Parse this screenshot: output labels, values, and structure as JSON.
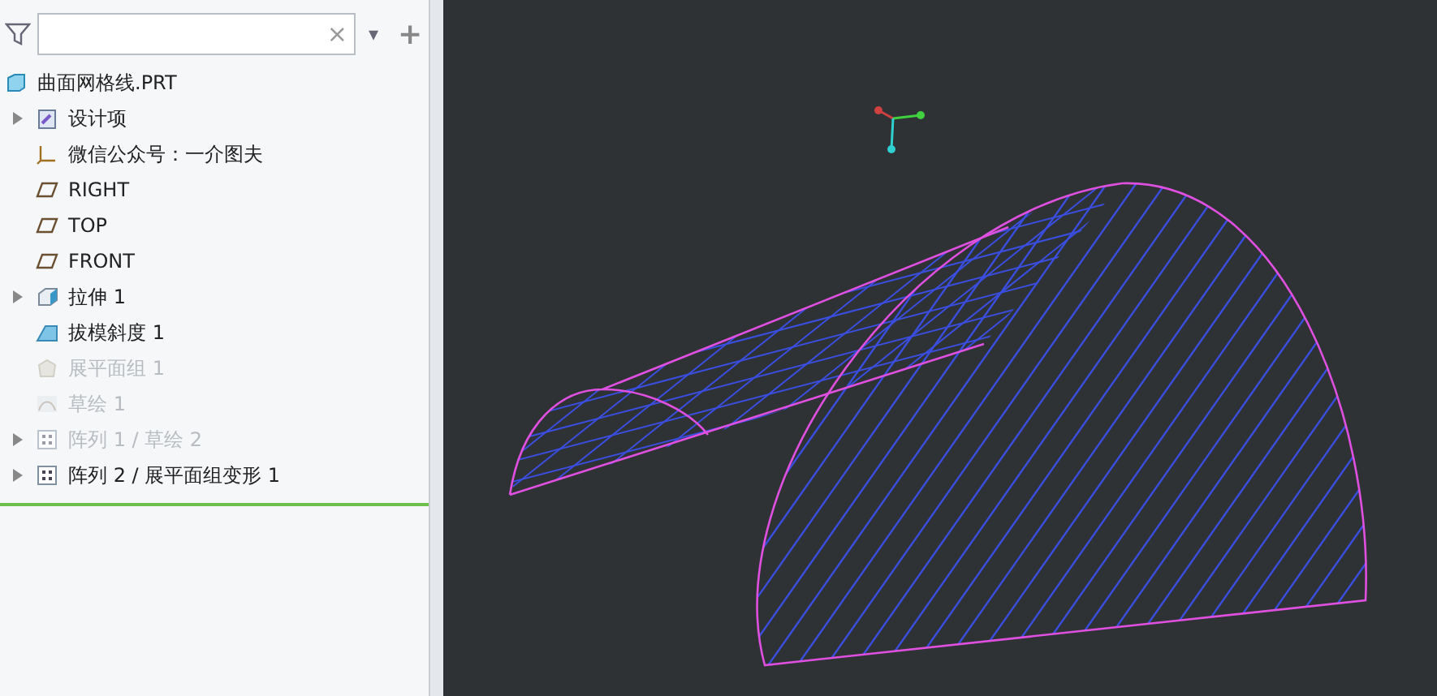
{
  "filter": {
    "clear": "×",
    "dropdown": "▾",
    "add": "+"
  },
  "tree": {
    "root": {
      "label": "曲面网格线.PRT",
      "kind": "part"
    },
    "items": [
      {
        "label": "设计项",
        "kind": "design",
        "expandable": true,
        "disabled": false
      },
      {
        "label": "微信公众号：一介图夫",
        "kind": "csys",
        "expandable": false,
        "disabled": false
      },
      {
        "label": "RIGHT",
        "kind": "plane",
        "expandable": false,
        "disabled": false
      },
      {
        "label": "TOP",
        "kind": "plane",
        "expandable": false,
        "disabled": false
      },
      {
        "label": "FRONT",
        "kind": "plane",
        "expandable": false,
        "disabled": false
      },
      {
        "label": "拉伸 1",
        "kind": "extrude",
        "expandable": true,
        "disabled": false
      },
      {
        "label": "拔模斜度 1",
        "kind": "draft",
        "expandable": false,
        "disabled": false
      },
      {
        "label": "展平面组 1",
        "kind": "flatten",
        "expandable": false,
        "disabled": true
      },
      {
        "label": "草绘 1",
        "kind": "sketch",
        "expandable": false,
        "disabled": true
      },
      {
        "label": "阵列 1 / 草绘 2",
        "kind": "pattern",
        "expandable": true,
        "disabled": true
      },
      {
        "label": "阵列 2 / 展平面组变形 1",
        "kind": "pattern",
        "expandable": true,
        "disabled": false
      }
    ]
  }
}
